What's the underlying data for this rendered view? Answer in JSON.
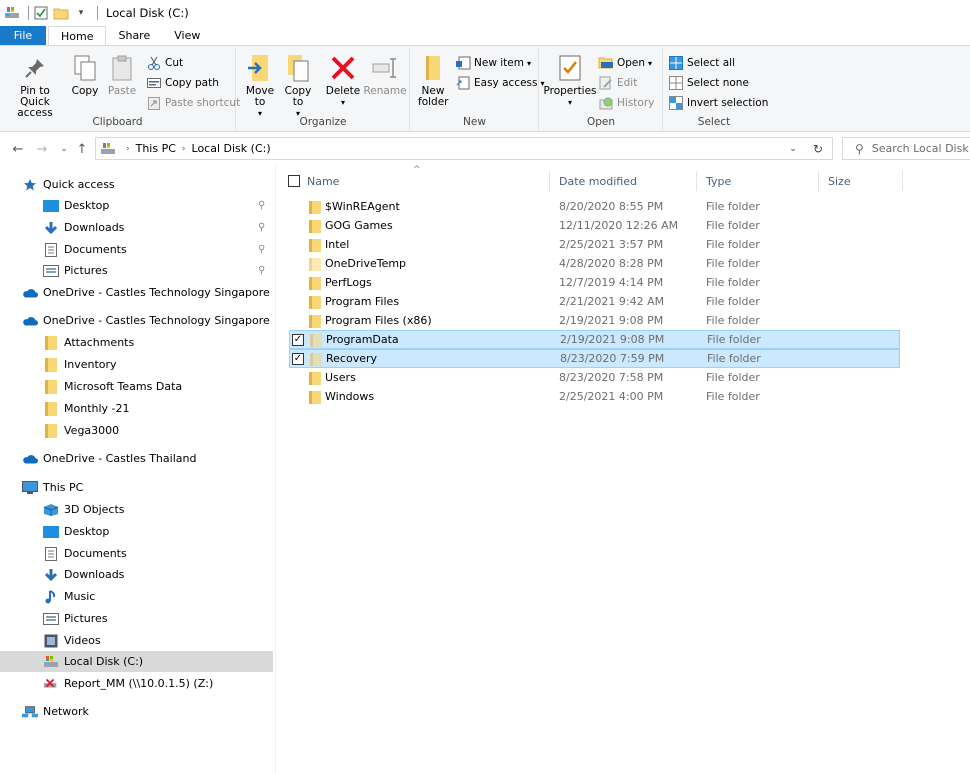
{
  "window": {
    "title": "Local Disk (C:)"
  },
  "ribbon_tabs": [
    "File",
    "Home",
    "Share",
    "View"
  ],
  "ribbon": {
    "clipboard": {
      "label": "Clipboard",
      "pin_label": "Pin to Quick access",
      "copy_label": "Copy",
      "paste_label": "Paste",
      "cut_label": "Cut",
      "copy_path_label": "Copy path",
      "paste_shortcut_label": "Paste shortcut"
    },
    "organize": {
      "label": "Organize",
      "move_label": "Move to",
      "copy_to_label": "Copy to",
      "delete_label": "Delete",
      "rename_label": "Rename"
    },
    "new": {
      "label": "New",
      "new_folder_label": "New folder",
      "new_item_label": "New item",
      "easy_access_label": "Easy access"
    },
    "open": {
      "label": "Open",
      "properties_label": "Properties",
      "open_label": "Open",
      "edit_label": "Edit",
      "history_label": "History"
    },
    "select": {
      "label": "Select",
      "select_all_label": "Select all",
      "select_none_label": "Select none",
      "invert_label": "Invert selection"
    }
  },
  "address": {
    "crumbs": [
      "This PC",
      "Local Disk (C:)"
    ],
    "search_placeholder": "Search Local Disk (C:)"
  },
  "nav_pane": [
    {
      "label": "Quick access",
      "icon": "star-icon"
    },
    {
      "label": "Desktop",
      "icon": "desktop-icon",
      "pinned": true
    },
    {
      "label": "Downloads",
      "icon": "download-icon",
      "pinned": true
    },
    {
      "label": "Documents",
      "icon": "document-icon",
      "pinned": true
    },
    {
      "label": "Pictures",
      "icon": "pictures-icon",
      "pinned": true
    },
    {
      "label": "OneDrive - Castles Technology Singapore Pte Ltd",
      "icon": "onedrive-icon"
    },
    {
      "label": "OneDrive - Castles Technology Singapore Pte Ltd",
      "icon": "onedrive-icon"
    },
    {
      "label": "Attachments",
      "icon": "folder-icon"
    },
    {
      "label": "Inventory",
      "icon": "folder-icon"
    },
    {
      "label": "Microsoft Teams Data",
      "icon": "folder-icon"
    },
    {
      "label": "Monthly -21",
      "icon": "folder-icon"
    },
    {
      "label": "Vega3000",
      "icon": "folder-icon"
    },
    {
      "label": "OneDrive - Castles Thailand",
      "icon": "onedrive-icon"
    },
    {
      "label": "This PC",
      "icon": "pc-icon"
    },
    {
      "label": "3D Objects",
      "icon": "3d-objects-icon"
    },
    {
      "label": "Desktop",
      "icon": "desktop-icon"
    },
    {
      "label": "Documents",
      "icon": "document-icon"
    },
    {
      "label": "Downloads",
      "icon": "download-icon"
    },
    {
      "label": "Music",
      "icon": "music-icon"
    },
    {
      "label": "Pictures",
      "icon": "pictures-icon"
    },
    {
      "label": "Videos",
      "icon": "videos-icon"
    },
    {
      "label": "Local Disk (C:)",
      "icon": "drive-icon",
      "selected": true
    },
    {
      "label": "Report_MM (\\\\10.0.1.5) (Z:)",
      "icon": "network-drive-icon"
    },
    {
      "label": "Network",
      "icon": "network-icon"
    }
  ],
  "columns": {
    "name": "Name",
    "date": "Date modified",
    "type": "Type",
    "size": "Size"
  },
  "files": [
    {
      "name": "$WinREAgent",
      "date": "8/20/2020 8:55 PM",
      "type": "File folder",
      "faded": false,
      "selected": false
    },
    {
      "name": "GOG Games",
      "date": "12/11/2020 12:26 AM",
      "type": "File folder",
      "faded": false,
      "selected": false
    },
    {
      "name": "Intel",
      "date": "2/25/2021 3:57 PM",
      "type": "File folder",
      "faded": false,
      "selected": false
    },
    {
      "name": "OneDriveTemp",
      "date": "4/28/2020 8:28 PM",
      "type": "File folder",
      "faded": true,
      "selected": false
    },
    {
      "name": "PerfLogs",
      "date": "12/7/2019 4:14 PM",
      "type": "File folder",
      "faded": false,
      "selected": false
    },
    {
      "name": "Program Files",
      "date": "2/21/2021 9:42 AM",
      "type": "File folder",
      "faded": false,
      "selected": false
    },
    {
      "name": "Program Files (x86)",
      "date": "2/19/2021 9:08 PM",
      "type": "File folder",
      "faded": false,
      "selected": false
    },
    {
      "name": "ProgramData",
      "date": "2/19/2021 9:08 PM",
      "type": "File folder",
      "faded": true,
      "selected": true
    },
    {
      "name": "Recovery",
      "date": "8/23/2020 7:59 PM",
      "type": "File folder",
      "faded": true,
      "selected": true
    },
    {
      "name": "Users",
      "date": "8/23/2020 7:58 PM",
      "type": "File folder",
      "faded": false,
      "selected": false
    },
    {
      "name": "Windows",
      "date": "2/25/2021 4:00 PM",
      "type": "File folder",
      "faded": false,
      "selected": false
    }
  ],
  "colors": {
    "file_tab": "#1979ca",
    "folder": "#f8d775",
    "selection": "#cce8ff",
    "nav_selected": "#d9d9d9",
    "onedrive": "#0f6cbd",
    "delete_red": "#e81123"
  }
}
